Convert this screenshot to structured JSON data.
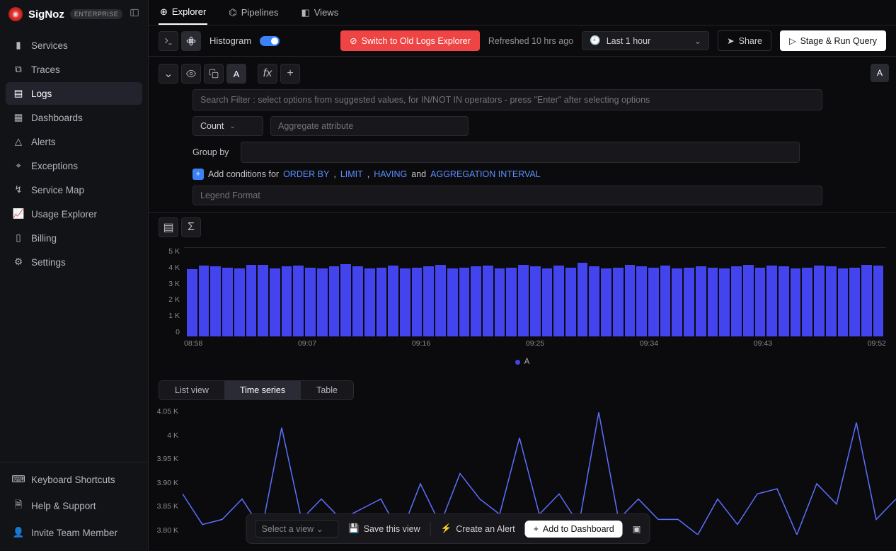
{
  "brand": {
    "name": "SigNoz",
    "badge": "ENTERPRISE"
  },
  "nav": {
    "items": [
      {
        "label": "Services",
        "icon": "bar-chart-icon"
      },
      {
        "label": "Traces",
        "icon": "link-icon"
      },
      {
        "label": "Logs",
        "icon": "logs-icon",
        "active": true
      },
      {
        "label": "Dashboards",
        "icon": "grid-icon"
      },
      {
        "label": "Alerts",
        "icon": "triangle-alert-icon"
      },
      {
        "label": "Exceptions",
        "icon": "bug-icon"
      },
      {
        "label": "Service Map",
        "icon": "route-icon"
      },
      {
        "label": "Usage Explorer",
        "icon": "chart-icon"
      },
      {
        "label": "Billing",
        "icon": "receipt-icon"
      },
      {
        "label": "Settings",
        "icon": "gear-icon"
      }
    ],
    "footer": [
      {
        "label": "Keyboard Shortcuts",
        "icon": "keyboard-icon"
      },
      {
        "label": "Help & Support",
        "icon": "file-icon"
      },
      {
        "label": "Invite Team Member",
        "icon": "user-plus-icon"
      }
    ]
  },
  "tabs": [
    {
      "label": "Explorer",
      "active": true
    },
    {
      "label": "Pipelines",
      "active": false
    },
    {
      "label": "Views",
      "active": false
    }
  ],
  "toolbar": {
    "histogram_label": "Histogram",
    "switch_label": "Switch to Old Logs Explorer",
    "refreshed": "Refreshed 10 hrs ago",
    "time_range": "Last 1 hour",
    "share": "Share",
    "run": "Stage & Run Query"
  },
  "query": {
    "tag": "A",
    "filter_placeholder": "Search Filter : select options from suggested values, for IN/NOT IN operators - press \"Enter\" after selecting options",
    "agg_func": "Count",
    "agg_attr_placeholder": "Aggregate attribute",
    "group_by_label": "Group by",
    "conditions": {
      "prefix": "Add conditions for",
      "order_by": "ORDER BY",
      "limit": "LIMIT",
      "having": "HAVING",
      "and": "and",
      "agg_interval": "AGGREGATION INTERVAL",
      "comma": ","
    },
    "legend_placeholder": "Legend Format"
  },
  "side_tag": "A",
  "chart_data": {
    "type": "bar",
    "categories": [
      "08:58",
      "09:07",
      "09:16",
      "09:25",
      "09:34",
      "09:43",
      "09:52"
    ],
    "y_ticks": [
      "5 K",
      "4 K",
      "3 K",
      "2 K",
      "1 K",
      "0"
    ],
    "ylim": [
      0,
      5000
    ],
    "series": [
      {
        "name": "A",
        "values": [
          3800,
          4000,
          3950,
          3900,
          3850,
          4050,
          4050,
          3850,
          3950,
          4000,
          3900,
          3850,
          3950,
          4100,
          3950,
          3850,
          3900,
          4000,
          3850,
          3900,
          3950,
          4050,
          3850,
          3900,
          3950,
          4000,
          3850,
          3900,
          4050,
          3950,
          3850,
          4000,
          3900,
          4150,
          3950,
          3850,
          3900,
          4050,
          3950,
          3900,
          4000,
          3850,
          3900,
          3950,
          3900,
          3850,
          3950,
          4050,
          3900,
          4000,
          3950,
          3850,
          3900,
          4000,
          3950,
          3850,
          3900,
          4050,
          4000
        ]
      }
    ],
    "legend_label": "A"
  },
  "view_switch": {
    "list": "List view",
    "timeseries": "Time series",
    "table": "Table",
    "active": "timeseries"
  },
  "ts_chart": {
    "type": "line",
    "y_ticks": [
      "4.05 K",
      "4 K",
      "3.95 K",
      "3.90 K",
      "3.85 K",
      "3.80 K"
    ],
    "ylim": [
      3800,
      4050
    ],
    "values": [
      3880,
      3820,
      3830,
      3870,
      3810,
      4010,
      3830,
      3870,
      3830,
      3850,
      3870,
      3800,
      3900,
      3820,
      3920,
      3870,
      3840,
      3990,
      3840,
      3880,
      3820,
      4040,
      3830,
      3870,
      3830,
      3830,
      3800,
      3870,
      3820,
      3880,
      3890,
      3800,
      3900,
      3860,
      4020,
      3830,
      3870
    ]
  },
  "bottom_bar": {
    "select_placeholder": "Select a view",
    "save_view": "Save this view",
    "create_alert": "Create an Alert",
    "add_dashboard": "Add to Dashboard"
  }
}
